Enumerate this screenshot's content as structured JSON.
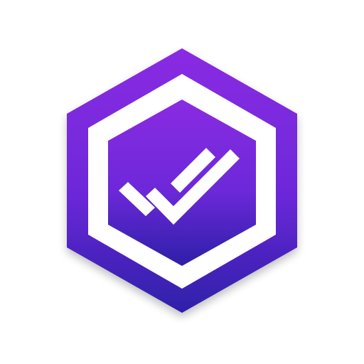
{
  "logo": {
    "icon": "hexagon-double-check-icon",
    "colors": {
      "background": "#ffffff",
      "gradient_top": "#8a2be2",
      "gradient_mid": "#6c28d9",
      "gradient_bottom": "#2d1fa8",
      "ring": "#ffffff",
      "check": "#ffffff"
    }
  }
}
